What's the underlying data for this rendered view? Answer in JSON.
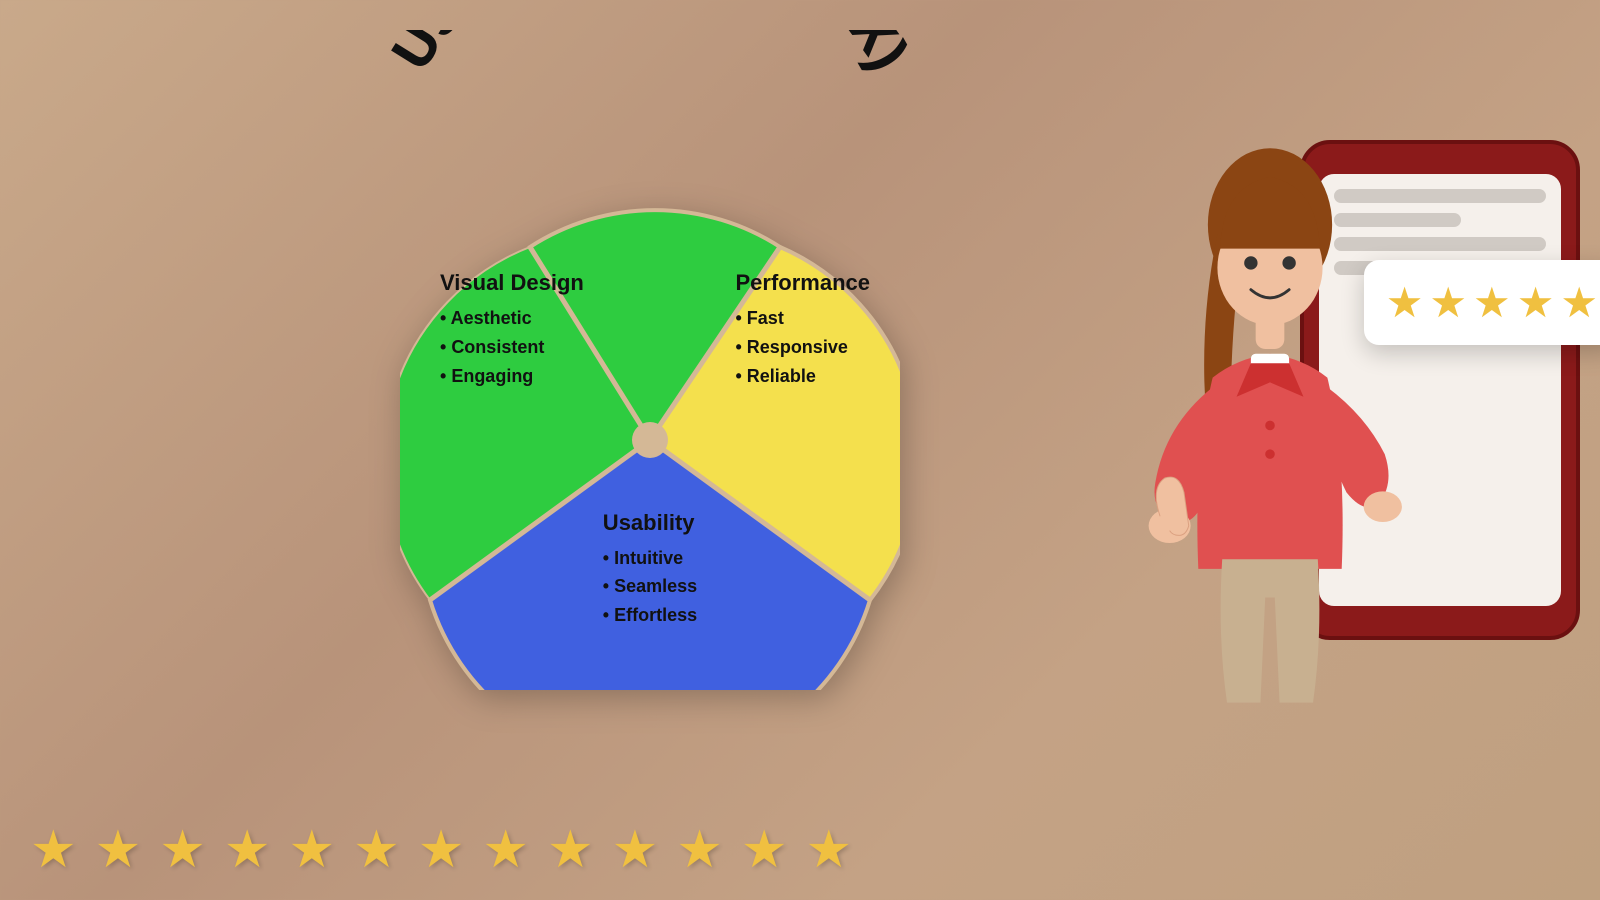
{
  "page": {
    "title": "User Experience (UX)",
    "background_color": "#c4a285"
  },
  "curved_title": {
    "text": "User Experience (UX)"
  },
  "segments": {
    "visual_design": {
      "title": "Visual Design",
      "items": [
        "Aesthetic",
        "Consistent",
        "Engaging"
      ],
      "color": "#2ecc40"
    },
    "performance": {
      "title": "Performance",
      "items": [
        "Fast",
        "Responsive",
        "Reliable"
      ],
      "color": "#f4e04d"
    },
    "usability": {
      "title": "Usability",
      "items": [
        "Intuitive",
        "Seamless",
        "Effortless"
      ],
      "color": "#4060e0"
    }
  },
  "bottom_stars": {
    "count": 13,
    "color": "#f0c040",
    "symbol": "★"
  },
  "rating_card": {
    "stars": 5,
    "symbol": "★",
    "color": "#f0c040"
  }
}
